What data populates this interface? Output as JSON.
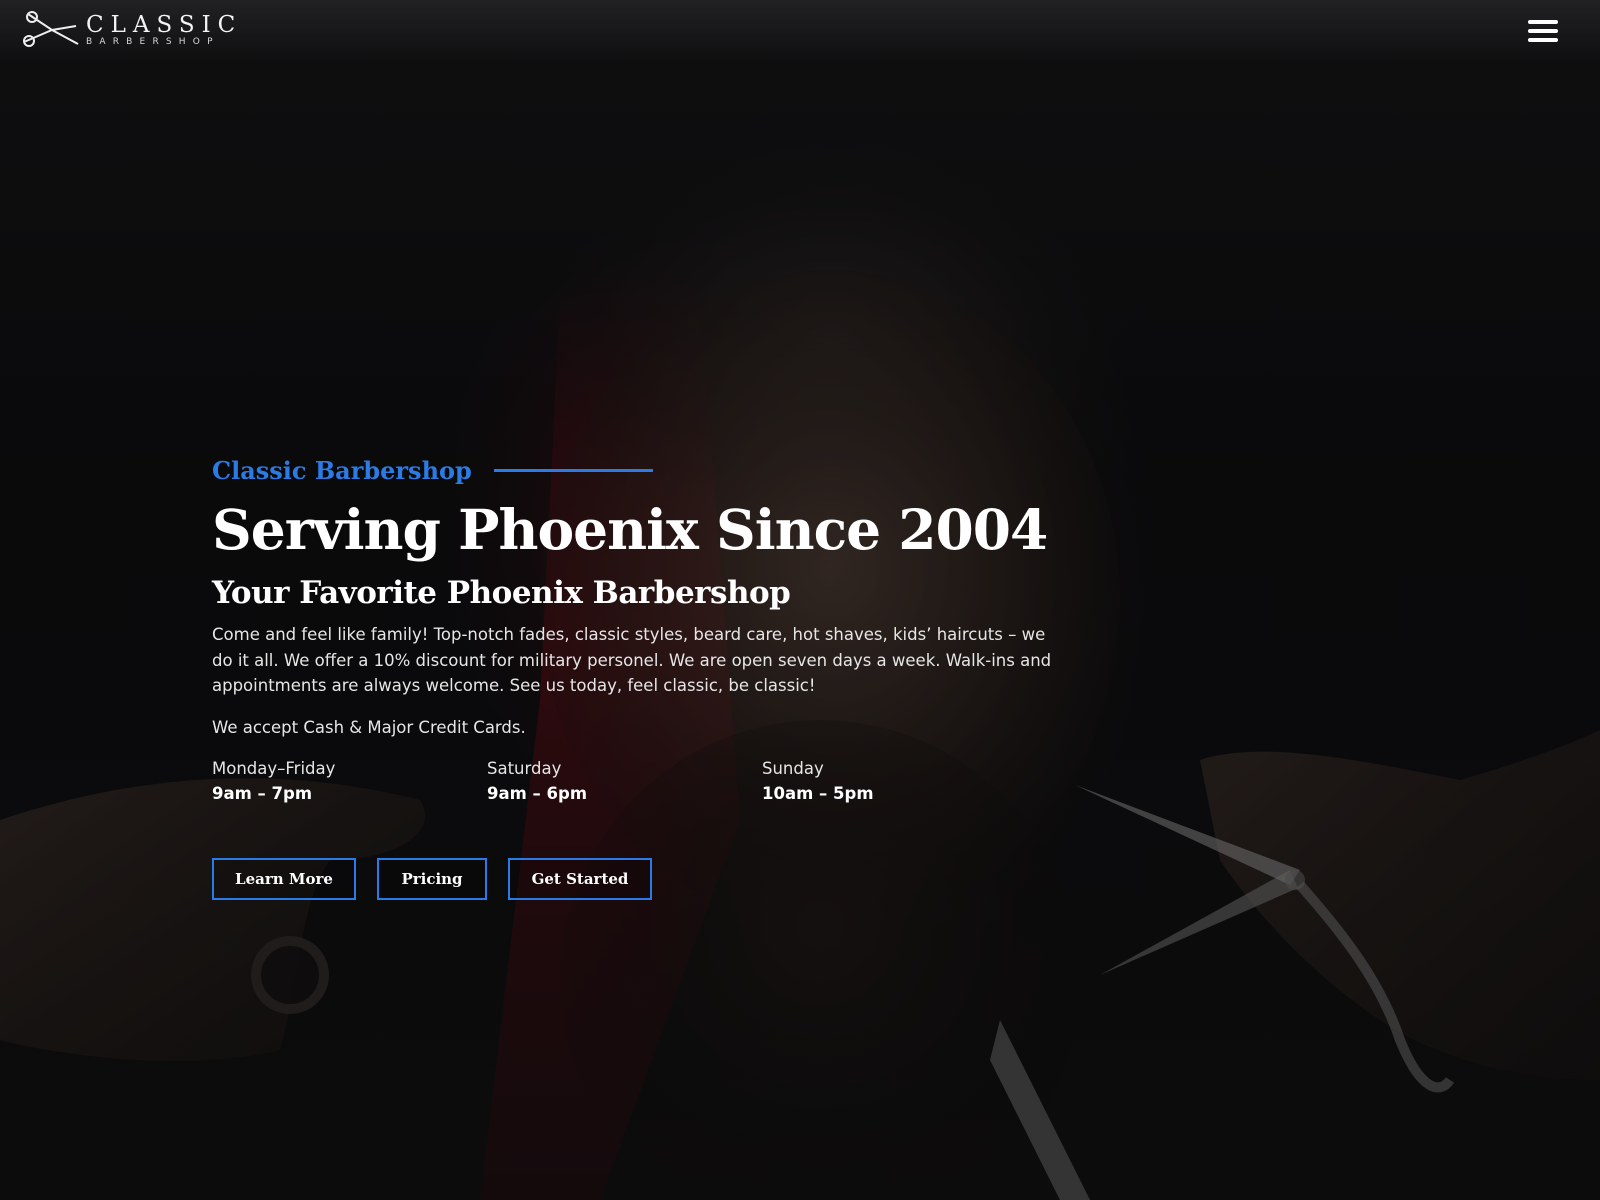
{
  "header": {
    "logo": {
      "main": "CLASSIC",
      "sub": "BARBERSHOP",
      "icon": "scissors-icon"
    },
    "menu_icon": "hamburger-menu-icon"
  },
  "hero": {
    "eyebrow": "Classic Barbershop",
    "title": "Serving Phoenix Since 2004",
    "subtitle": "Your Favorite Phoenix Barbershop",
    "description": "Come and feel like family! Top-notch fades, classic styles, beard care, hot shaves, kids’ haircuts – we do it all. We offer a 10% discount for military personel.  We are open seven days a week. Walk-ins and appointments are always welcome. See us today, feel classic, be classic!",
    "payment": "We accept Cash & Major Credit Cards.",
    "hours": [
      {
        "day": "Monday–Friday",
        "time": "9am – 7pm"
      },
      {
        "day": "Saturday",
        "time": "9am – 6pm"
      },
      {
        "day": "Sunday",
        "time": "10am – 5pm"
      }
    ],
    "buttons": {
      "learn_more": "Learn More",
      "pricing": "Pricing",
      "get_started": "Get Started"
    }
  },
  "colors": {
    "accent": "#2b7be6",
    "background": "#0e0e10",
    "text": "#ffffff"
  }
}
